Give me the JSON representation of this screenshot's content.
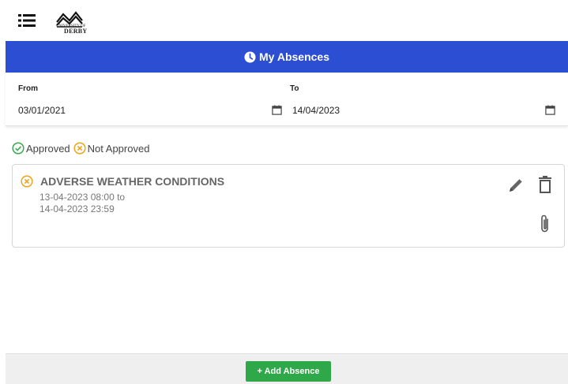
{
  "logo": {
    "subtitle": "UNIVERSITY OF",
    "name": "DERBY"
  },
  "header": {
    "title": "My Absences"
  },
  "dates": {
    "from_label": "From",
    "from_value": "03/01/2021",
    "to_label": "To",
    "to_value": "14/04/2023"
  },
  "legend": {
    "approved": "Approved",
    "not_approved": "Not Approved"
  },
  "absences": [
    {
      "title": "ADVERSE WEATHER CONDITIONS",
      "start": "13-04-2023 08:00 to",
      "end": "14-04-2023 23:59",
      "status": "not-approved"
    }
  ],
  "footer": {
    "add_label": "+ Add Absence"
  },
  "colors": {
    "header": "#2b4ed3",
    "approved": "#3aa94c",
    "not_approved": "#f0a21a",
    "add_button": "#2fa84a"
  }
}
